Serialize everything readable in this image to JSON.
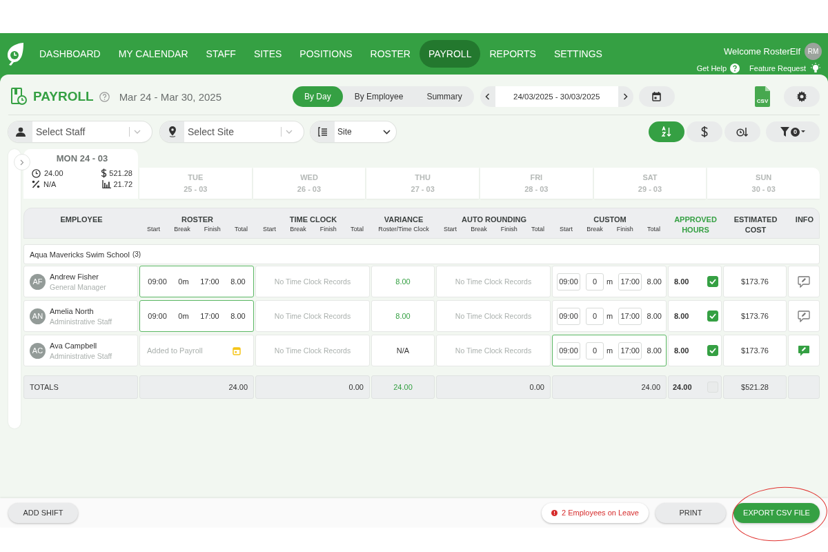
{
  "nav": {
    "items": [
      {
        "label": "DASHBOARD",
        "selected": false
      },
      {
        "label": "MY CALENDAR",
        "selected": false
      },
      {
        "label": "STAFF",
        "selected": false
      },
      {
        "label": "SITES",
        "selected": false
      },
      {
        "label": "POSITIONS",
        "selected": false
      },
      {
        "label": "ROSTER",
        "selected": false
      },
      {
        "label": "PAYROLL",
        "selected": true
      },
      {
        "label": "REPORTS",
        "selected": false
      },
      {
        "label": "SETTINGS",
        "selected": false
      }
    ],
    "welcome": "Welcome RosterElf",
    "avatar": "RM",
    "links": [
      {
        "label": "Get Help",
        "kind": "help"
      },
      {
        "label": "Feature Request",
        "kind": "idea"
      }
    ]
  },
  "header": {
    "title": "PAYROLL",
    "date_range": "Mar 24 - Mar 30, 2025",
    "views": [
      {
        "label": "By Day",
        "selected": true
      },
      {
        "label": "By Employee",
        "selected": false
      },
      {
        "label": "Summary",
        "selected": false
      }
    ],
    "period": "24/03/2025 - 30/03/2025",
    "csv_label": "CSV"
  },
  "filters": {
    "staff": {
      "placeholder": "Select Staff"
    },
    "site": {
      "placeholder": "Select Site"
    },
    "group_by": "Site",
    "sorts": [
      {
        "kind": "alpha",
        "selected": true
      },
      {
        "kind": "cost",
        "selected": false
      },
      {
        "kind": "clock",
        "selected": false
      }
    ],
    "filter_count": "0"
  },
  "days": [
    {
      "name": "MON",
      "date": "24 - 03",
      "selected": true,
      "stats": [
        {
          "kind": "hours",
          "value": "24.00"
        },
        {
          "kind": "cost",
          "value": "521.28"
        },
        {
          "kind": "percent",
          "value": "N/A"
        },
        {
          "kind": "chart",
          "value": "21.72"
        }
      ]
    },
    {
      "name": "TUE",
      "date": "25 - 03",
      "selected": false
    },
    {
      "name": "WED",
      "date": "26 - 03",
      "selected": false
    },
    {
      "name": "THU",
      "date": "27 - 03",
      "selected": false
    },
    {
      "name": "FRI",
      "date": "28 - 03",
      "selected": false
    },
    {
      "name": "SAT",
      "date": "29 - 03",
      "selected": false
    },
    {
      "name": "SUN",
      "date": "30 - 03",
      "selected": false
    }
  ],
  "table": {
    "columns": [
      {
        "title": "EMPLOYEE",
        "accent": false
      },
      {
        "title": "ROSTER",
        "accent": false,
        "sub": [
          "Start",
          "Break",
          "Finish",
          "Total"
        ]
      },
      {
        "title": "TIME CLOCK",
        "accent": false,
        "sub": [
          "Start",
          "Break",
          "Finish",
          "Total"
        ]
      },
      {
        "title": "VARIANCE",
        "accent": false,
        "sub": [
          "Roster/Time Clock"
        ]
      },
      {
        "title": "AUTO ROUNDING",
        "accent": false,
        "sub": [
          "Start",
          "Break",
          "Finish",
          "Total"
        ]
      },
      {
        "title": "CUSTOM",
        "accent": false,
        "sub": [
          "Start",
          "Break",
          "Finish",
          "Total"
        ]
      },
      {
        "title": "APPROVED HOURS",
        "accent": true
      },
      {
        "title": "ESTIMATED COST",
        "accent": false
      },
      {
        "title": "INFO",
        "accent": false
      }
    ],
    "group": {
      "name": "Aqua Mavericks Swim School",
      "count": "(3)"
    },
    "rows": [
      {
        "initials": "AF",
        "name": "Andrew Fisher",
        "position": "General Manager",
        "roster": {
          "kind": "shift",
          "start": "09:00",
          "break": "0m",
          "finish": "17:00",
          "total": "8.00",
          "highlighted": true
        },
        "time_clock": "No Time Clock Records",
        "variance": {
          "value": "8.00",
          "positive": true
        },
        "auto_rounding": "No Time Clock Records",
        "custom": {
          "start": "09:00",
          "break": "0",
          "unit": "m",
          "finish": "17:00",
          "total": "8.00",
          "highlighted": false
        },
        "approved": {
          "hours": "8.00",
          "checked": true
        },
        "cost": "$173.76",
        "info_active": false
      },
      {
        "initials": "AN",
        "name": "Amelia North",
        "position": "Administrative Staff",
        "roster": {
          "kind": "shift",
          "start": "09:00",
          "break": "0m",
          "finish": "17:00",
          "total": "8.00",
          "highlighted": true
        },
        "time_clock": "No Time Clock Records",
        "variance": {
          "value": "8.00",
          "positive": true
        },
        "auto_rounding": "No Time Clock Records",
        "custom": {
          "start": "09:00",
          "break": "0",
          "unit": "m",
          "finish": "17:00",
          "total": "8.00",
          "highlighted": false
        },
        "approved": {
          "hours": "8.00",
          "checked": true
        },
        "cost": "$173.76",
        "info_active": false
      },
      {
        "initials": "AC",
        "name": "Ava Campbell",
        "position": "Administrative Staff",
        "roster": {
          "kind": "note",
          "text": "Added to Payroll"
        },
        "time_clock": "No Time Clock Records",
        "variance": {
          "value": "N/A",
          "positive": false
        },
        "auto_rounding": "No Time Clock Records",
        "custom": {
          "start": "09:00",
          "break": "0",
          "unit": "m",
          "finish": "17:00",
          "total": "8.00",
          "highlighted": true
        },
        "approved": {
          "hours": "8.00",
          "checked": true
        },
        "cost": "$173.76",
        "info_active": true
      }
    ],
    "totals": {
      "label": "TOTALS",
      "roster": "24.00",
      "time_clock": "0.00",
      "variance": "24.00",
      "variance_positive": true,
      "auto_rounding": "0.00",
      "custom": "24.00",
      "approved": "24.00",
      "approved_checked": false,
      "cost": "$521.28"
    }
  },
  "footer": {
    "add_shift": "ADD SHIFT",
    "leave_notice": "2 Employees on Leave",
    "print": "PRINT",
    "export": "EXPORT CSV FILE",
    "export_circled": true
  }
}
